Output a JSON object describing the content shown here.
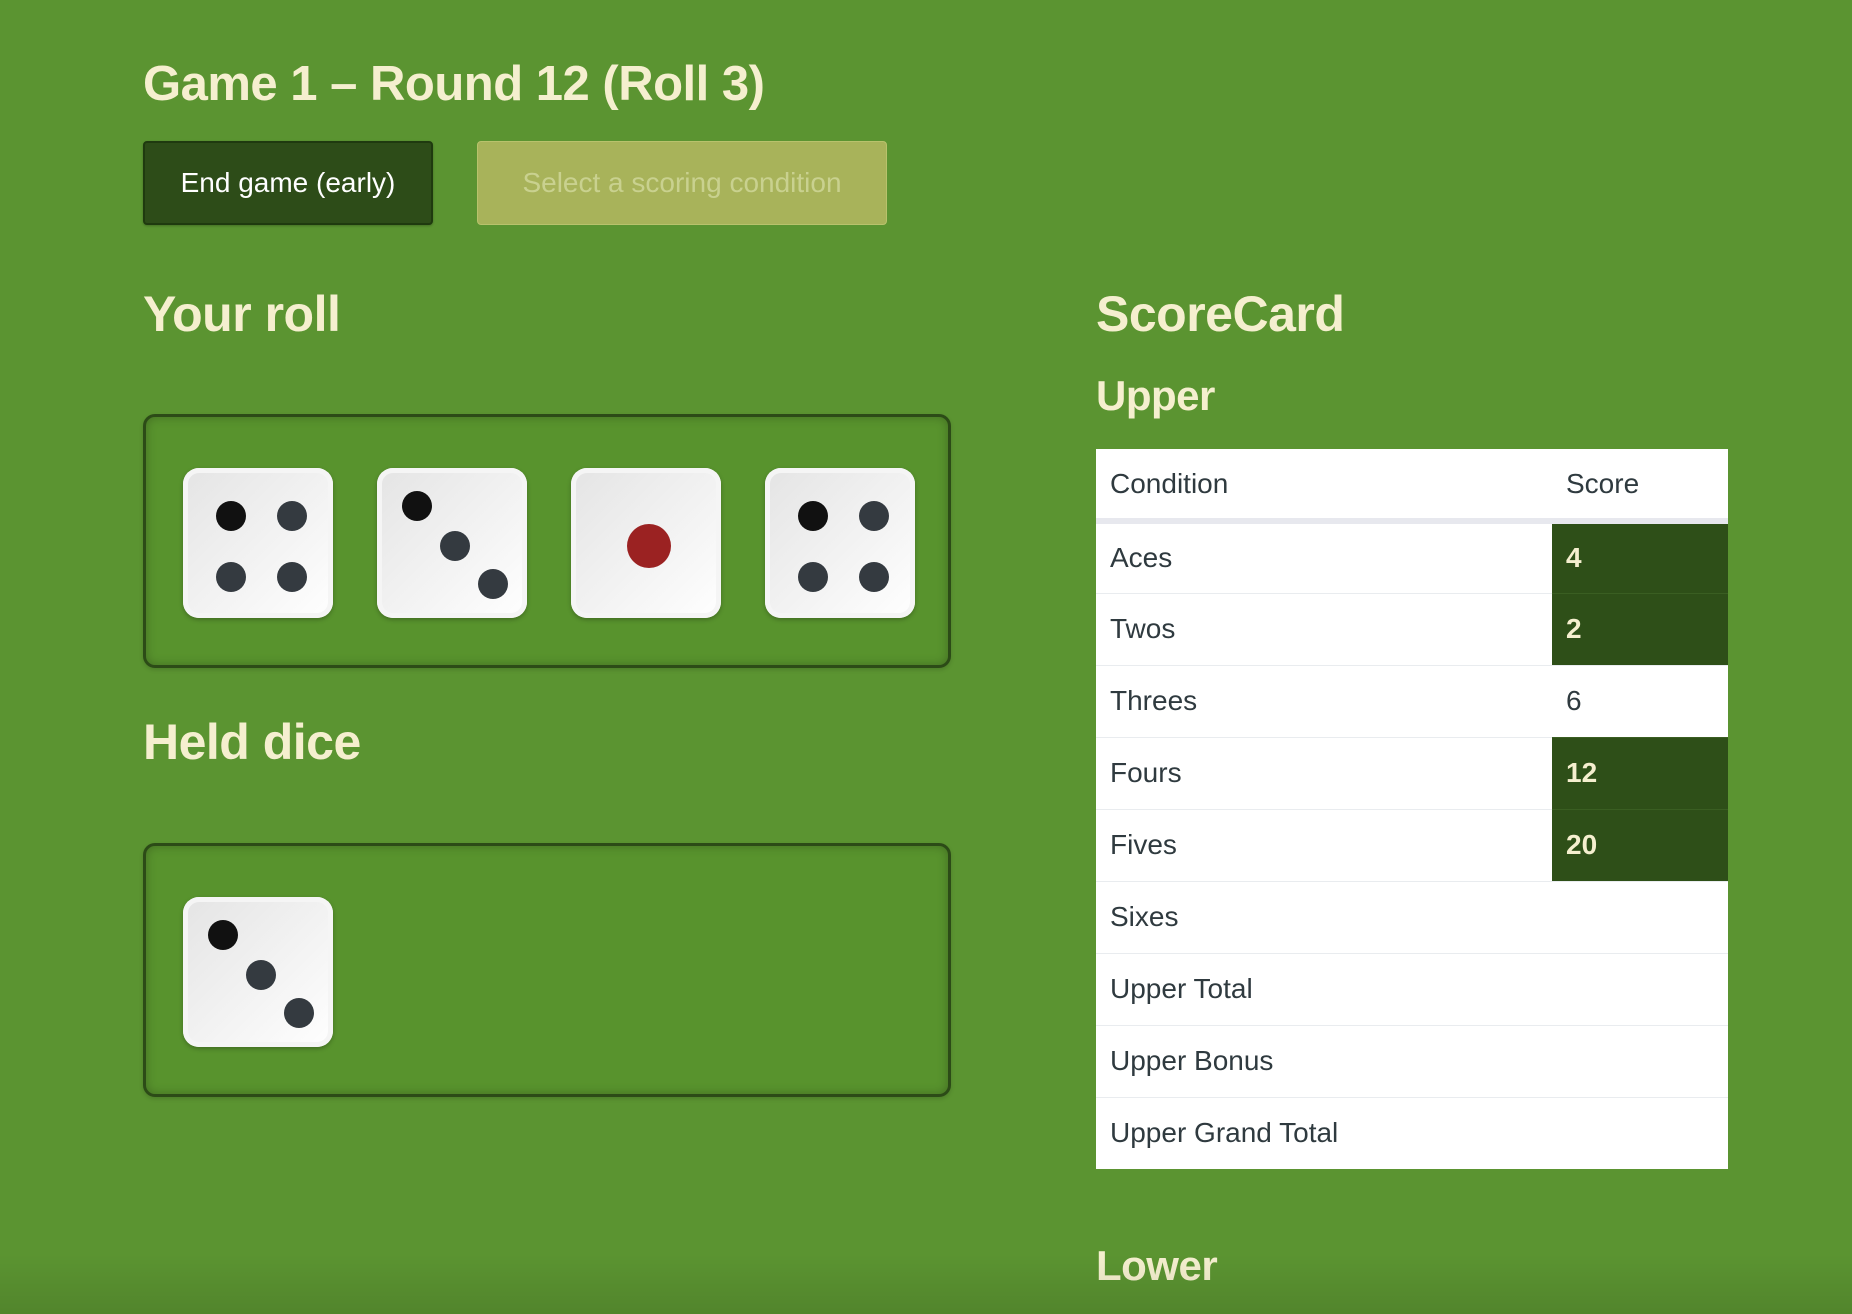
{
  "game": {
    "title": "Game 1 – Round 12 (Roll 3)",
    "end_button_label": "End game (early)",
    "select_button_label": "Select a scoring condition"
  },
  "sections": {
    "your_roll": "Your roll",
    "held_dice": "Held dice",
    "scorecard": "ScoreCard",
    "upper": "Upper",
    "lower": "Lower"
  },
  "roll": {
    "dice": [
      {
        "value": 4
      },
      {
        "value": 3
      },
      {
        "value": 1
      },
      {
        "value": 4
      }
    ]
  },
  "held": {
    "dice": [
      {
        "value": 3
      }
    ]
  },
  "scorecard": {
    "headers": {
      "condition": "Condition",
      "score": "Score"
    },
    "upper_rows": [
      {
        "condition": "Aces",
        "score": "4",
        "used": true
      },
      {
        "condition": "Twos",
        "score": "2",
        "used": true
      },
      {
        "condition": "Threes",
        "score": "6",
        "used": false
      },
      {
        "condition": "Fours",
        "score": "12",
        "used": true
      },
      {
        "condition": "Fives",
        "score": "20",
        "used": true
      },
      {
        "condition": "Sixes",
        "score": "",
        "used": false
      },
      {
        "condition": "Upper Total",
        "score": "",
        "used": false
      },
      {
        "condition": "Upper Bonus",
        "score": "",
        "used": false
      },
      {
        "condition": "Upper Grand Total",
        "score": "",
        "used": false
      }
    ]
  },
  "colors": {
    "background": "#5b9431",
    "heading": "#f5efcf",
    "dark_green": "#2d4c18",
    "pip": "#343a40",
    "pip_corner": "#111111",
    "pip_one": "#9b2222"
  }
}
